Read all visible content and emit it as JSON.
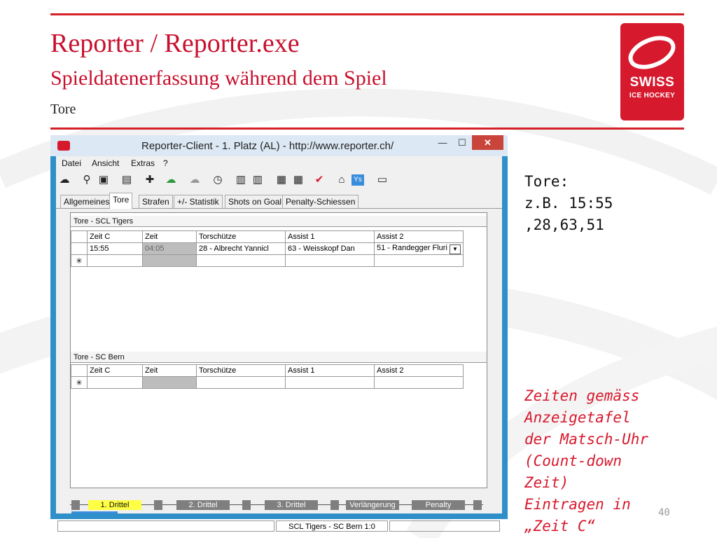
{
  "slide": {
    "title": "Reporter / Reporter.exe",
    "subtitle": "Spieldatenerfassung während dem Spiel",
    "section": "Tore",
    "page_number": "40",
    "accent_color": "#d7192d"
  },
  "logo": {
    "line1": "SWISS",
    "line2": "ICE HOCKEY"
  },
  "window": {
    "title": "Reporter-Client  -  1. Platz (AL)  -  http://www.reporter.ch/",
    "minimize": "—",
    "maximize": "☐",
    "close": "✕"
  },
  "menu": [
    "Datei",
    "Ansicht",
    "Extras",
    "?"
  ],
  "toolbar_icons": [
    "cloud-download-icon",
    "search-icon",
    "save-icon",
    "clipboard-icon",
    "player-add-icon",
    "cloud-upload-icon",
    "cloud-icon",
    "stopwatch-icon",
    "lineup-icon",
    "lineup-icon",
    "team-icon",
    "team-icon",
    "checkmark-icon",
    "home-icon",
    "ys-icon",
    "tv-icon"
  ],
  "tabs": [
    "Allgemeines",
    "Tore",
    "Strafen",
    "+/- Statistik",
    "Shots on Goal",
    "Penalty-Schiessen"
  ],
  "groups": [
    {
      "header": "Tore - SCL Tigers",
      "columns": [
        "Zeit C",
        "Zeit",
        "Torschütze",
        "Assist 1",
        "Assist 2"
      ],
      "rows": [
        [
          "15:55",
          "04:05",
          "28 - Albrecht Yannicl",
          "63 - Weisskopf Dan",
          "51 - Randegger Fluri"
        ]
      ],
      "new_row_marker": "✳"
    },
    {
      "header": "Tore - SC Bern",
      "columns": [
        "Zeit C",
        "Zeit",
        "Torschütze",
        "Assist 1",
        "Assist 2"
      ],
      "rows": [],
      "new_row_marker": "✳"
    }
  ],
  "periods": [
    "1. Drittel",
    "2. Drittel",
    "3. Drittel",
    "Verlängerung",
    "Penalty"
  ],
  "active_period": "1. Drittel",
  "status": {
    "score": "SCL Tigers - SC Bern 1:0"
  },
  "notes": {
    "tore": "Tore:\nz.B. 15:55\n,28,63,51",
    "zeiten": "Zeiten gemäss\nAnzeigetafel\nder Matsch-Uhr\n(Count-down\nZeit)\nEintragen in\n„Zeit C“"
  }
}
